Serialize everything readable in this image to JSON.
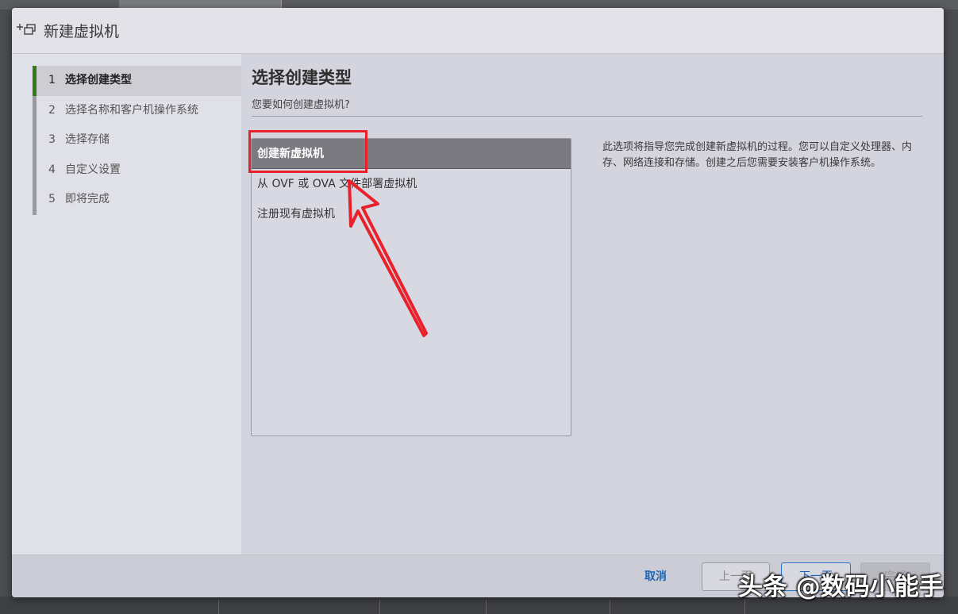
{
  "window": {
    "title": "新建虚拟机",
    "icon": "new-vm-icon"
  },
  "wizard": {
    "steps": [
      {
        "num": "1",
        "label": "选择创建类型",
        "active": true
      },
      {
        "num": "2",
        "label": "选择名称和客户机操作系统",
        "active": false
      },
      {
        "num": "3",
        "label": "选择存储",
        "active": false
      },
      {
        "num": "4",
        "label": "自定义设置",
        "active": false
      },
      {
        "num": "5",
        "label": "即将完成",
        "active": false
      }
    ]
  },
  "page": {
    "title": "选择创建类型",
    "subtitle": "您要如何创建虚拟机?",
    "creation_types": [
      {
        "label": "创建新虚拟机",
        "selected": true
      },
      {
        "label": "从 OVF 或 OVA 文件部署虚拟机",
        "selected": false
      },
      {
        "label": "注册现有虚拟机",
        "selected": false
      }
    ],
    "description": "此选项将指导您完成创建新虚拟机的过程。您可以自定义处理器、内存、网络连接和存储。创建之后您需要安装客户机操作系统。"
  },
  "footer": {
    "cancel": "取消",
    "prev": "上一页",
    "next": "下一页",
    "finish": "完成"
  },
  "watermark": "头条 @数码小能手",
  "colors": {
    "accent": "#1a66b8",
    "active_step_bar": "#2e7d18",
    "annotation": "#e8212b",
    "selected_row": "#7a7a80"
  }
}
